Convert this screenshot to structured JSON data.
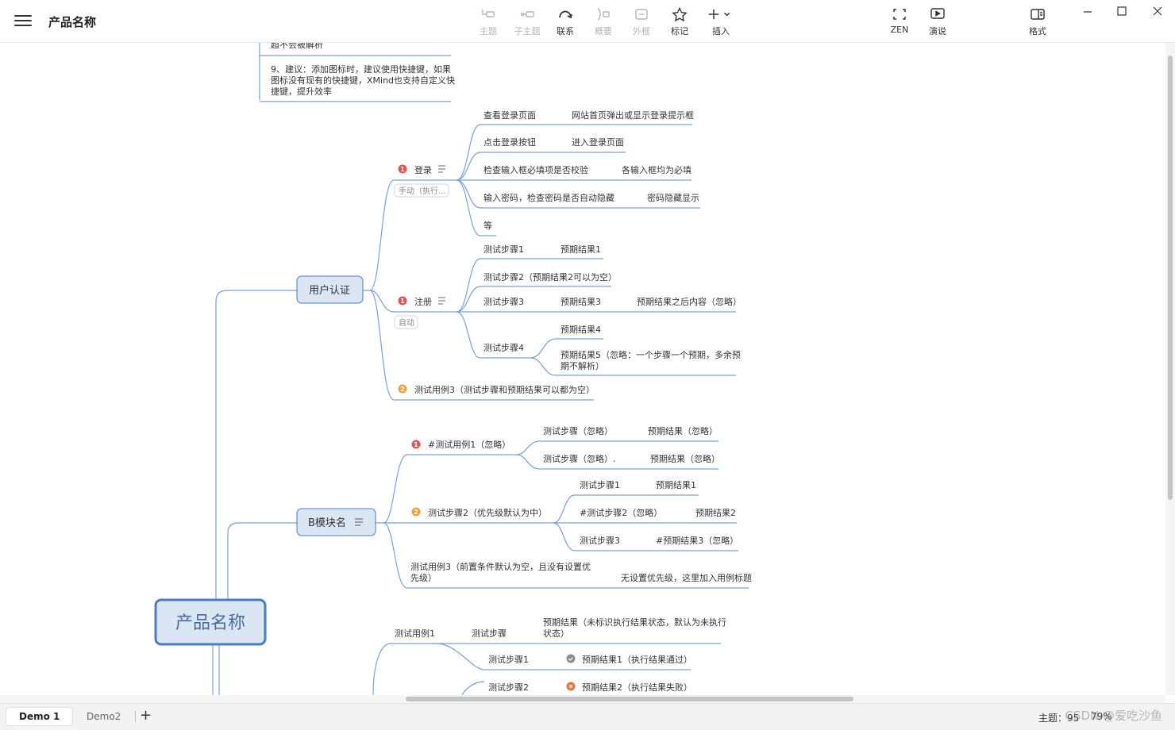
{
  "app": {
    "title": "产品名称"
  },
  "toolbar": {
    "topic": "主题",
    "subtopic": "子主题",
    "relationship": "联系",
    "summary": "概要",
    "boundary": "外框",
    "marker": "标记",
    "insert": "插入",
    "zen": "ZEN",
    "present": "演说",
    "format": "格式"
  },
  "map": {
    "central": "产品名称",
    "top_notes": {
      "partial": "超不会被解析",
      "note9_l1": "9、建议：添加图标时，建议使用快捷键，如果",
      "note9_l2": "图标没有现有的快捷键，XMind也支持自定义快",
      "note9_l3": "捷键，提升效率"
    },
    "branch_auth": {
      "label": "用户认证",
      "login": {
        "label": "登录",
        "priority": "1",
        "tag": "手动（执行...",
        "steps": [
          {
            "step": "查看登录页面",
            "result": "网站首页弹出或显示登录提示框"
          },
          {
            "step": "点击登录按钮",
            "result": "进入登录页面"
          },
          {
            "step": "检查输入框必填项是否校验",
            "result": "各输入框均为必填"
          },
          {
            "step": "输入密码，检查密码是否自动隐藏",
            "result": "密码隐藏显示"
          },
          {
            "step": "等"
          }
        ]
      },
      "register": {
        "label": "注册",
        "priority": "1",
        "tag": "自动",
        "step1": "测试步骤1",
        "result1": "预期结果1",
        "step2": "测试步骤2（预期结果2可以为空）",
        "step3": "测试步骤3",
        "result3": "预期结果3",
        "result3_after": "预期结果之后内容（忽略）",
        "step4": "测试步骤4",
        "result4": "预期结果4",
        "result5_l1": "预期结果5（忽略：一个步骤一个预期，多余预",
        "result5_l2": "期不解析）"
      },
      "case3": {
        "label": "测试用例3（测试步骤和预期结果可以都为空）",
        "priority": "2"
      }
    },
    "branch_b": {
      "label": "B模块名",
      "case1": {
        "label": "#测试用例1（忽略）",
        "priority": "1",
        "step_a": "测试步骤（忽略）",
        "result_a": "预期结果（忽略）",
        "step_b": "测试步骤（忽略）.",
        "result_b": "预期结果（忽略）"
      },
      "case2": {
        "label": "测试步骤2（优先级默认为中）",
        "priority": "2",
        "step1": "测试步骤1",
        "result1": "预期结果1",
        "step2": "#测试步骤2（忽略）",
        "result2": "预期结果2",
        "step3": "测试步骤3",
        "result3": "#预期结果3（忽略）"
      },
      "case3": {
        "label_l1": "测试用例3（前置条件默认为空，且没有设置优",
        "label_l2": "先级）",
        "result": "无设置优先级，这里加入用例标题"
      }
    },
    "branch_c": {
      "case1": "测试用例1",
      "step": "测试步骤",
      "result_l1": "预期结果（未标识执行结果状态，默认为未执行",
      "result_l2": "状态）",
      "step1": "测试步骤1",
      "result1": "预期结果1（执行结果通过）",
      "step2": "测试步骤2",
      "result2": "预期结果2（执行结果失败）"
    }
  },
  "sheets": [
    {
      "label": "Demo 1"
    },
    {
      "label": "Demo2"
    }
  ],
  "status": {
    "topic_label": "主题：",
    "topic_count": "95",
    "zoom": "79%"
  },
  "watermark": "CSDN @爱吃沙鱼",
  "colors": {
    "accent": "#4a7bc0",
    "node_fill": "#dbe6f4",
    "node_border": "#7094c8",
    "line": "#7a9fd4",
    "priority_red": "#e25555",
    "priority_orange": "#f0a040",
    "done_gray": "#8c8c8c",
    "fail_orange": "#e8733a"
  }
}
